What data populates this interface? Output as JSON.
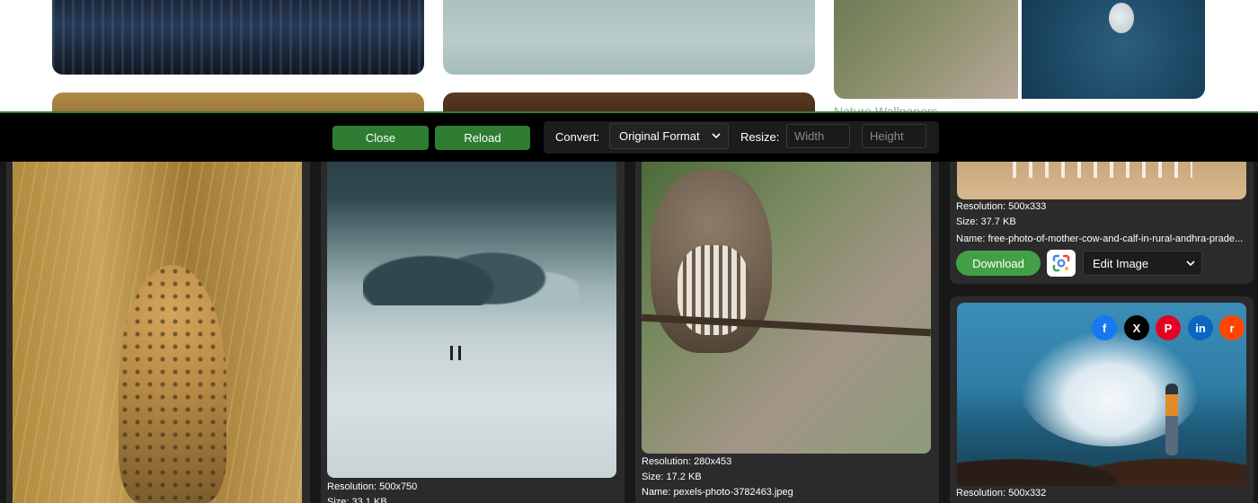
{
  "background": {
    "section_heading": "Nature Wallpapers"
  },
  "toolbar": {
    "close_label": "Close",
    "reload_label": "Reload",
    "convert_label": "Convert:",
    "format_value": "Original Format",
    "resize_label": "Resize:",
    "width_placeholder": "Width",
    "height_placeholder": "Height",
    "accent_color": "#2e7d32"
  },
  "images": [
    {
      "subject": "leopard",
      "resolution": "",
      "size": "",
      "name": ""
    },
    {
      "subject": "snow-field-skiers",
      "resolution": "Resolution: 500x750",
      "size": "Size: 33.1 KB",
      "name": ""
    },
    {
      "subject": "owl-on-branch",
      "resolution": "Resolution: 280x453",
      "size": "Size: 17.2 KB",
      "name": "Name: pexels-photo-3782463.jpeg"
    },
    {
      "subject": "cow-and-calf",
      "resolution": "Resolution: 500x333",
      "size": "Size: 37.7 KB",
      "name": "Name: free-photo-of-mother-cow-and-calf-in-rural-andhra-prade..."
    },
    {
      "subject": "sea-waves-person",
      "resolution": "Resolution: 500x332",
      "size": "",
      "name": ""
    }
  ],
  "actions": {
    "download_label": "Download",
    "edit_select_value": "Edit Image",
    "download_color": "#43a047"
  },
  "share": {
    "facebook": "f",
    "x": "X",
    "pinterest": "P",
    "linkedin": "in",
    "reddit": "r",
    "icons": [
      "facebook-icon",
      "x-icon",
      "pinterest-icon",
      "linkedin-icon",
      "reddit-icon"
    ]
  }
}
